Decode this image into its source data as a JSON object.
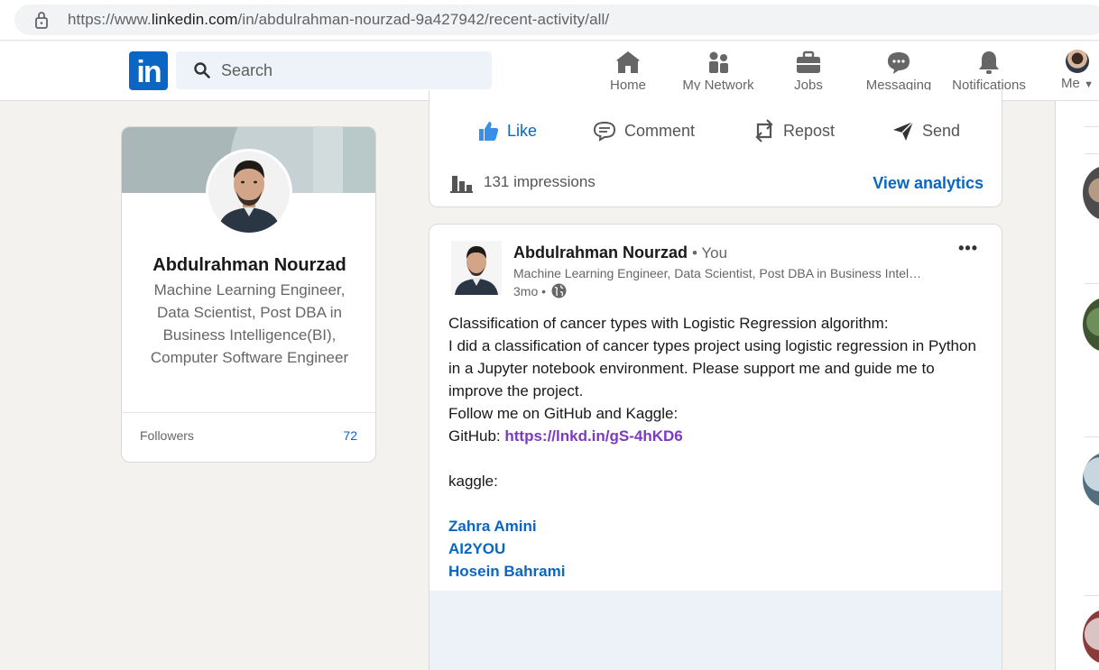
{
  "browser": {
    "url_prefix": "https://www.",
    "url_host": "linkedin.com",
    "url_path": "/in/abdulrahman-nourzad-9a427942/recent-activity/all/"
  },
  "nav": {
    "logo": "in",
    "search_placeholder": "Search",
    "items": [
      {
        "label": "Home",
        "icon": "home-icon"
      },
      {
        "label": "My Network",
        "icon": "network-icon"
      },
      {
        "label": "Jobs",
        "icon": "briefcase-icon"
      },
      {
        "label": "Messaging",
        "icon": "messaging-icon"
      },
      {
        "label": "Notifications",
        "icon": "bell-icon"
      },
      {
        "label": "Me",
        "icon": "avatar"
      }
    ]
  },
  "profile": {
    "name": "Abdulrahman Nourzad",
    "headline": "Machine Learning Engineer, Data Scientist, Post DBA in Business Intelligence(BI), Computer Software Engineer",
    "followers_label": "Followers",
    "followers_count": "72"
  },
  "post1": {
    "actions": {
      "like": "Like",
      "comment": "Comment",
      "repost": "Repost",
      "send": "Send"
    },
    "impressions": "131 impressions",
    "analytics": "View analytics"
  },
  "post2": {
    "author": "Abdulrahman Nourzad",
    "you": "• You",
    "headline": "Machine Learning Engineer, Data Scientist, Post DBA in Business Intel…",
    "time": "3mo •",
    "more": "•••",
    "body": {
      "line1": "Classification of cancer types with Logistic Regression algorithm:",
      "line2": "I did a classification of cancer types project using logistic regression in Python in a Jupyter notebook environment. Please support me and guide me to improve the project.",
      "line3": "Follow me on GitHub and Kaggle:",
      "github_label": "GitHub: ",
      "github_link": "https://lnkd.in/gS-4hKD6",
      "kaggle_label": "kaggle:",
      "mentions": [
        "Zahra Amini",
        "AI2YOU",
        "Hosein Bahrami"
      ]
    }
  },
  "colors": {
    "brand": "#0a66c2",
    "link_visited": "#7d3ac1",
    "page_bg": "#f3f2ef"
  }
}
